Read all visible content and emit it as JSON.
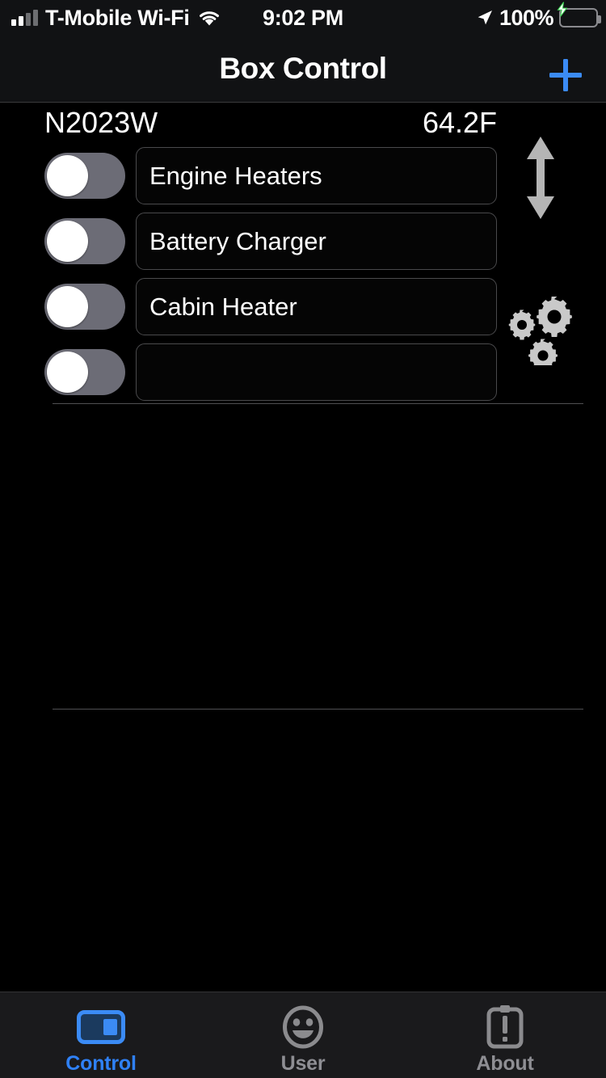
{
  "status_bar": {
    "carrier": "T-Mobile Wi-Fi",
    "signal_icon": "signal-bars-icon",
    "signal_bars_total": 4,
    "signal_bars_filled": 2,
    "wifi_icon": "wifi-icon",
    "time": "9:02 PM",
    "location_icon": "location-arrow-icon",
    "battery_percent": "100%",
    "battery_icon": "battery-charging-icon",
    "battery_color": "#3cd552"
  },
  "nav_bar": {
    "title": "Box Control",
    "add_icon": "plus-icon",
    "add_color": "#2f81f7"
  },
  "content": {
    "tail_number": "N2023W",
    "temperature": "64.2F",
    "reorder_icon": "up-down-arrow-icon",
    "settings_icon": "gears-icon",
    "rows": [
      {
        "toggle_state": "off",
        "name": "Engine Heaters",
        "placeholder": ""
      },
      {
        "toggle_state": "off",
        "name": "Battery Charger",
        "placeholder": ""
      },
      {
        "toggle_state": "off",
        "name": "Cabin Heater",
        "placeholder": ""
      },
      {
        "toggle_state": "off",
        "name": "",
        "placeholder": ""
      }
    ]
  },
  "tab_bar": {
    "active_color": "#2f81f7",
    "inactive_color": "#8e8e93",
    "tabs": [
      {
        "label": "Control",
        "icon": "toggle-panel-icon",
        "active": true
      },
      {
        "label": "User",
        "icon": "smiley-face-icon",
        "active": false
      },
      {
        "label": "About",
        "icon": "clipboard-info-icon",
        "active": false
      }
    ]
  }
}
